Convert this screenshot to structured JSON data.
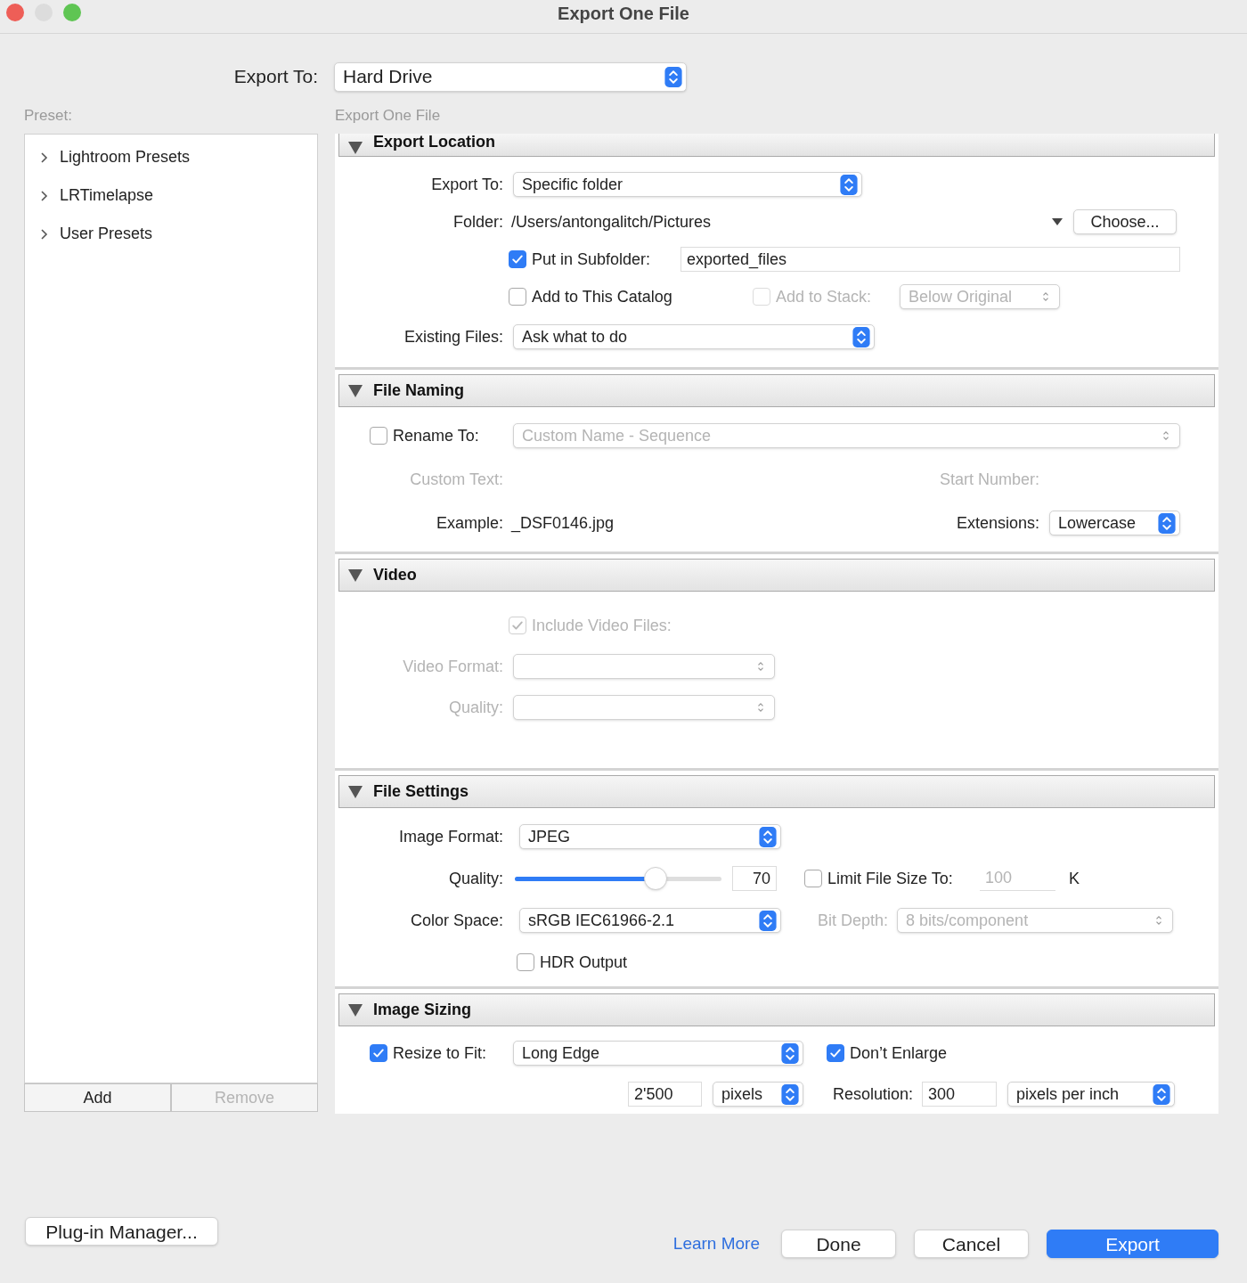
{
  "window": {
    "title": "Export One File"
  },
  "export_to": {
    "label": "Export To:",
    "value": "Hard Drive"
  },
  "preset_panel": {
    "label": "Preset:",
    "items": [
      {
        "label": "Lightroom Presets",
        "expanded": false
      },
      {
        "label": "LRTimelapse",
        "expanded": false
      },
      {
        "label": "User Presets",
        "expanded": false
      }
    ],
    "buttons": [
      {
        "label": "Add",
        "disabled": false
      },
      {
        "label": "Remove",
        "disabled": true
      }
    ]
  },
  "settings_panel": {
    "label": "Export One File",
    "sections": {
      "export_location": {
        "title": "Export Location",
        "expanded": true,
        "export_to": {
          "label": "Export To:",
          "value": "Specific folder"
        },
        "folder": {
          "label": "Folder:",
          "value": "/Users/antongalitch/Pictures",
          "button": "Choose..."
        },
        "subfolder": {
          "label": "Put in Subfolder:",
          "checked": true,
          "value": "exported_files"
        },
        "add_to_catalog": {
          "label": "Add to This Catalog",
          "checked": false
        },
        "add_to_stack": {
          "label": "Add to Stack:",
          "checked": false,
          "disabled": true,
          "value": "Below Original"
        },
        "existing_files": {
          "label": "Existing Files:",
          "value": "Ask what to do"
        }
      },
      "file_naming": {
        "title": "File Naming",
        "expanded": true,
        "rename_to": {
          "label": "Rename To:",
          "checked": false,
          "value": "Custom Name - Sequence",
          "disabled": true
        },
        "custom_text": {
          "label": "Custom Text:",
          "disabled": true
        },
        "start_number": {
          "label": "Start Number:",
          "disabled": true
        },
        "example": {
          "label": "Example:",
          "value": "_DSF0146.jpg"
        },
        "extensions": {
          "label": "Extensions:",
          "value": "Lowercase"
        }
      },
      "video": {
        "title": "Video",
        "expanded": true,
        "include_video": {
          "label": "Include Video Files:",
          "checked": true,
          "disabled": true
        },
        "video_format": {
          "label": "Video Format:",
          "disabled": true
        },
        "quality": {
          "label": "Quality:",
          "disabled": true
        }
      },
      "file_settings": {
        "title": "File Settings",
        "expanded": true,
        "image_format": {
          "label": "Image Format:",
          "value": "JPEG"
        },
        "quality": {
          "label": "Quality:",
          "level": 0.68,
          "value": "70"
        },
        "limit_file_size": {
          "label": "Limit File Size To:",
          "checked": false,
          "value": "100",
          "unit": "K",
          "disabled": true
        },
        "color_space": {
          "label": "Color Space:",
          "value": "sRGB IEC61966-2.1"
        },
        "bit_depth": {
          "label": "Bit Depth:",
          "value": "8 bits/component",
          "disabled": true
        },
        "hdr_output": {
          "label": "HDR Output",
          "checked": false
        }
      },
      "image_sizing": {
        "title": "Image Sizing",
        "expanded": true,
        "resize_to_fit": {
          "label": "Resize to Fit:",
          "checked": true,
          "value": "Long Edge"
        },
        "dont_enlarge": {
          "label": "Don’t Enlarge",
          "checked": true
        },
        "size": {
          "value": "2'500",
          "unit": "pixels"
        },
        "resolution": {
          "label": "Resolution:",
          "value": "300",
          "unit": "pixels per inch"
        }
      }
    }
  },
  "footer": {
    "plugin_button": "Plug-in Manager...",
    "link": "Learn More",
    "buttons": [
      {
        "label": "Done",
        "primary": false
      },
      {
        "label": "Cancel",
        "primary": false
      },
      {
        "label": "Export",
        "primary": true
      }
    ]
  }
}
